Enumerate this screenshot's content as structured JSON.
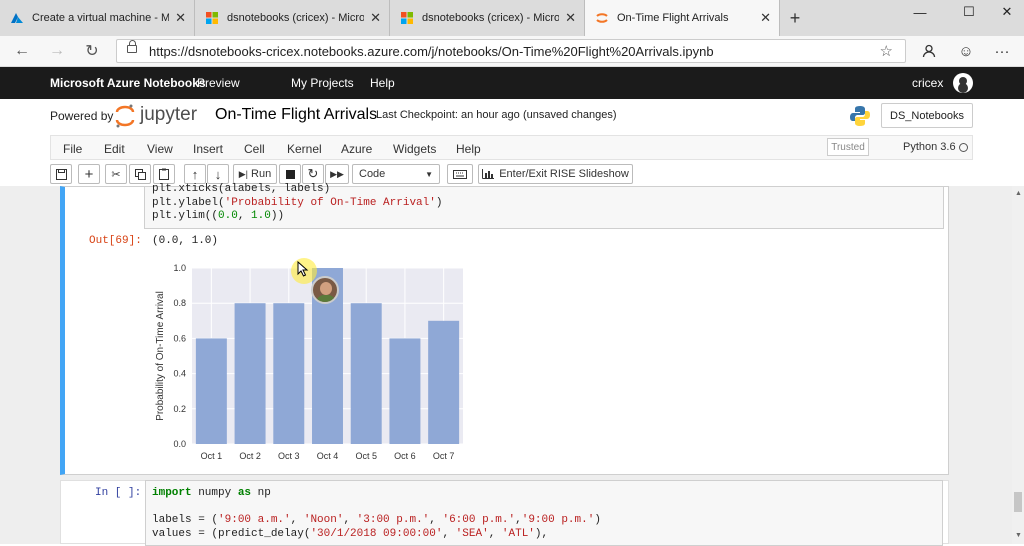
{
  "tabs": [
    {
      "title": "Create a virtual machine - Micros",
      "icon": "azure-icon"
    },
    {
      "title": "dsnotebooks (cricex) - Microsoft",
      "icon": "ms-icon"
    },
    {
      "title": "dsnotebooks (cricex) - Microsoft",
      "icon": "ms-icon"
    },
    {
      "title": "On-Time Flight Arrivals",
      "icon": "jupyter-icon"
    }
  ],
  "address": {
    "url": "https://dsnotebooks-cricex.notebooks.azure.com/j/notebooks/On-Time%20Flight%20Arrivals.ipynb"
  },
  "azure_bar": {
    "brand": "Microsoft Azure Notebooks",
    "preview": "Preview",
    "my_projects": "My Projects",
    "help": "Help",
    "user": "cricex"
  },
  "jupyter": {
    "powered_by": "Powered by",
    "logo_text": "jupyter",
    "notebook_title": "On-Time Flight Arrivals",
    "checkpoint": "Last Checkpoint: an hour ago",
    "unsaved": "(unsaved changes)",
    "project_button": "DS_Notebooks"
  },
  "menu": [
    "File",
    "Edit",
    "View",
    "Insert",
    "Cell",
    "Kernel",
    "Azure",
    "Widgets",
    "Help"
  ],
  "status": {
    "trusted": "Trusted",
    "kernel": "Python 3.6"
  },
  "toolbar": {
    "run": "Run",
    "cell_type": "Code",
    "rise": "Enter/Exit RISE Slideshow"
  },
  "cells": {
    "code1_lines": [
      "plt.xticks(alabels, labels)",
      "plt.ylabel('Probability of On-Time Arrival')",
      "plt.ylim((0.0, 1.0))"
    ],
    "out_prompt": "Out[69]:",
    "out_text": "(0.0, 1.0)",
    "in_prompt": "In [ ]:",
    "code2_lines": [
      "import numpy as np",
      "",
      "labels = ('9:00 a.m.', 'Noon', '3:00 p.m.', '6:00 p.m.','9:00 p.m.')",
      "values = (predict_delay('30/1/2018 09:00:00', 'SEA', 'ATL'),"
    ]
  },
  "chart_data": {
    "type": "bar",
    "categories": [
      "Oct 1",
      "Oct 2",
      "Oct 3",
      "Oct 4",
      "Oct 5",
      "Oct 6",
      "Oct 7"
    ],
    "values": [
      0.6,
      0.8,
      0.8,
      1.0,
      0.8,
      0.6,
      0.7
    ],
    "ylabel": "Probability of On-Time Arrival",
    "xlabel": "",
    "ylim": [
      0.0,
      1.0
    ],
    "yticks": [
      "0.0",
      "0.2",
      "0.4",
      "0.6",
      "0.8",
      "1.0"
    ],
    "grid": true,
    "bar_color": "#8fa8d6",
    "plot_bg": "#eaeaf2"
  },
  "colors": {
    "accent": "#42a5f5",
    "azure_bar": "#1b1b1b",
    "jupyter_orange": "#f37626"
  }
}
